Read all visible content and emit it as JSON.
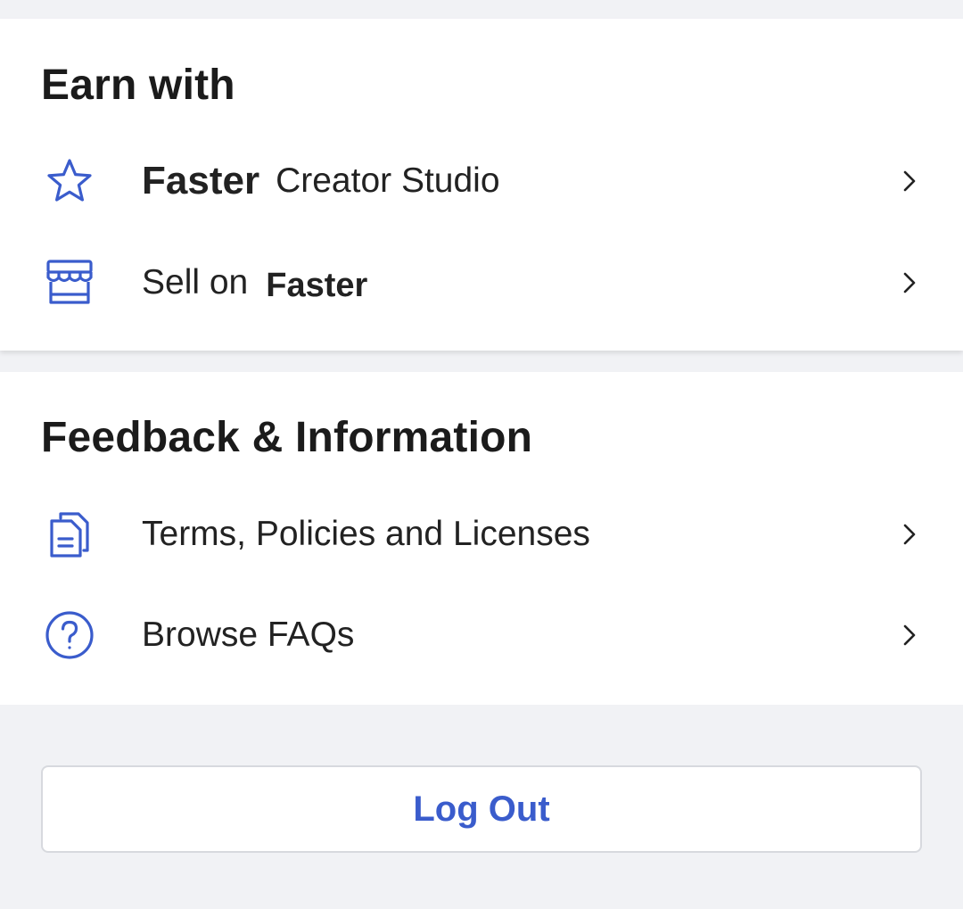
{
  "colors": {
    "accent": "#3a5ccc",
    "icon": "#3a5ccc",
    "background": "#f1f2f5",
    "card": "#ffffff",
    "text": "#222222"
  },
  "earn_section": {
    "title": "Earn with",
    "items": [
      {
        "icon": "star-icon",
        "brand": "Faster",
        "label": "Creator Studio"
      },
      {
        "icon": "storefront-icon",
        "label": "Sell on",
        "brand": "Faster"
      }
    ]
  },
  "feedback_section": {
    "title": "Feedback & Information",
    "items": [
      {
        "icon": "documents-icon",
        "label": "Terms, Policies and Licenses"
      },
      {
        "icon": "help-circle-icon",
        "label": "Browse FAQs"
      }
    ]
  },
  "logout": {
    "label": "Log Out"
  }
}
